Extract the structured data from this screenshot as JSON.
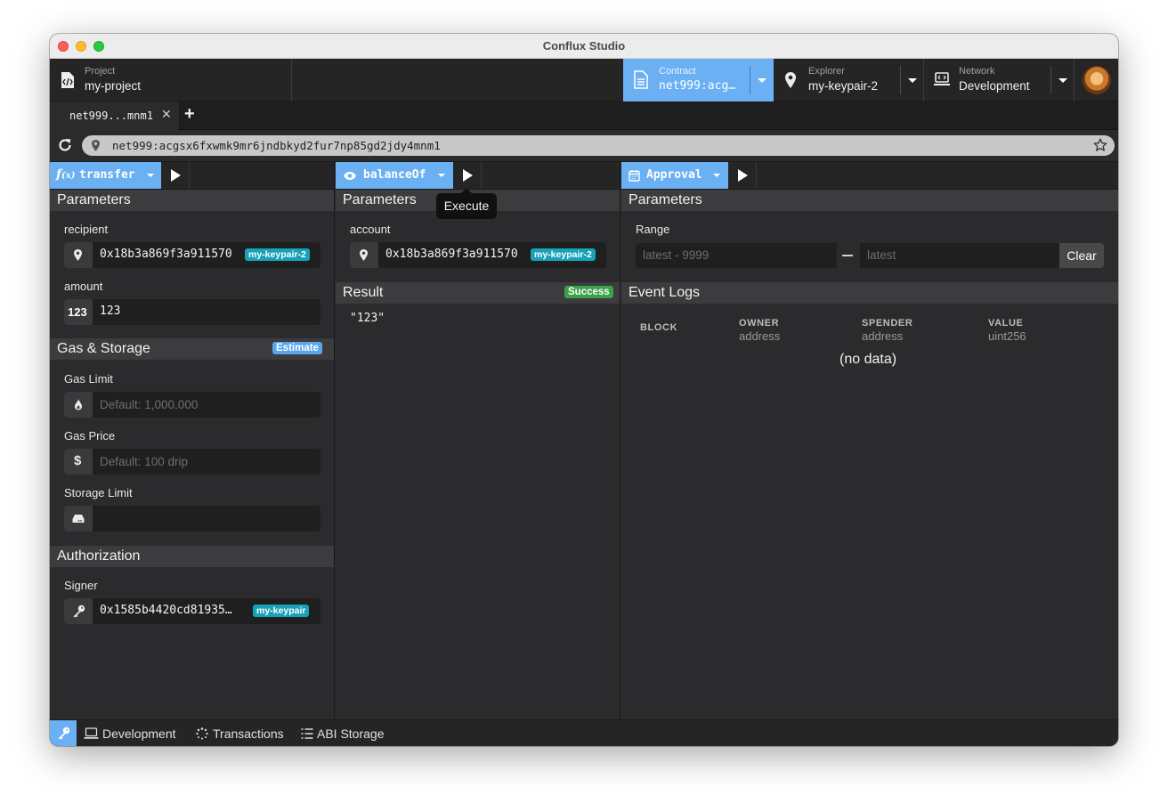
{
  "window": {
    "title": "Conflux Studio"
  },
  "header": {
    "project": {
      "label": "Project",
      "value": "my-project",
      "icon": "file-code-icon"
    },
    "contract": {
      "label": "Contract",
      "value": "net999:acg…",
      "icon": "document-icon"
    },
    "explorer": {
      "label": "Explorer",
      "value": "my-keypair-2",
      "icon": "map-pin-icon"
    },
    "network": {
      "label": "Network",
      "value": "Development",
      "icon": "laptop-code-icon"
    },
    "avatar": "user-avatar"
  },
  "tabs": [
    {
      "label": "net999...mnm1"
    }
  ],
  "address_bar": {
    "value": "net999:acgsx6fxwmk9mr6jndbkyd2fur7np85gd2jdy4mnm1"
  },
  "left": {
    "function": "transfer",
    "parameters_title": "Parameters",
    "recipient": {
      "label": "recipient",
      "value": "0x18b3a869f3a911570",
      "badge": "my-keypair-2"
    },
    "amount": {
      "label": "amount",
      "prefix": "123",
      "value": "123"
    },
    "gas_title": "Gas & Storage",
    "estimate_badge": "Estimate",
    "gas_limit": {
      "label": "Gas Limit",
      "placeholder": "Default: 1,000,000"
    },
    "gas_price": {
      "label": "Gas Price",
      "placeholder": "Default: 100 drip"
    },
    "storage_limit": {
      "label": "Storage Limit",
      "placeholder": ""
    },
    "auth_title": "Authorization",
    "signer": {
      "label": "Signer",
      "value": "0x1585b4420cd81935…",
      "badge": "my-keypair"
    }
  },
  "middle": {
    "function": "balanceOf",
    "tooltip": "Execute",
    "parameters_title": "Parameters",
    "account": {
      "label": "account",
      "value": "0x18b3a869f3a911570",
      "badge": "my-keypair-2"
    },
    "result_title": "Result",
    "result_badge": "Success",
    "result_value": "\"123\""
  },
  "right": {
    "event": "Approval",
    "parameters_title": "Parameters",
    "range_label": "Range",
    "range_from_placeholder": "latest - 9999",
    "range_to_placeholder": "latest",
    "clear_label": "Clear",
    "logs_title": "Event Logs",
    "columns": [
      {
        "name": "BLOCK",
        "type": ""
      },
      {
        "name": "OWNER",
        "type": "address"
      },
      {
        "name": "SPENDER",
        "type": "address"
      },
      {
        "name": "VALUE",
        "type": "uint256"
      }
    ],
    "empty_text": "(no data)"
  },
  "statusbar": {
    "items": [
      {
        "label": "Development",
        "icon": "laptop-code-icon"
      },
      {
        "label": "Transactions",
        "icon": "spinner-icon"
      },
      {
        "label": "ABI Storage",
        "icon": "list-icon"
      }
    ]
  },
  "colors": {
    "accent": "#6ab0f3",
    "success": "#3ba24a",
    "keypair_badge": "#17a2b8"
  }
}
